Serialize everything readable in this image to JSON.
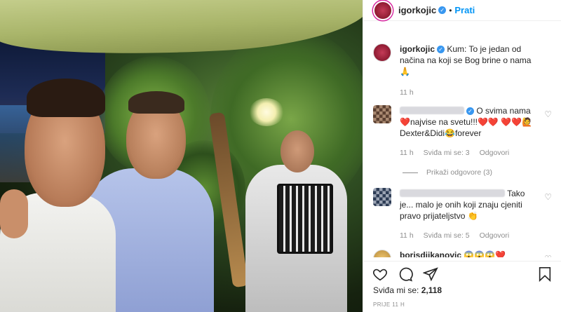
{
  "post": {
    "username": "igorkojic",
    "follow_label": "Prati",
    "dot": "•",
    "caption": {
      "username": "igorkojic",
      "text": "Kum: To je jedan od načina na koji se Bog brine o nama 🙏",
      "time": "11 h"
    },
    "likes_label": "Sviđa mi se:",
    "likes_count": "2,118",
    "posted_time": "PRIJE 11 H"
  },
  "comments": [
    {
      "text": "O svima nama❤️najvise na svetu!!!❤️❤️ ❤️❤️🙋Dexter&Didi😂forever",
      "time": "11 h",
      "likes": "Sviđa mi se: 3",
      "reply": "Odgovori",
      "view_replies": "Prikaži odgovore (3)"
    },
    {
      "text": "Tako je... malo je onih koji znaju cjeniti pravo prijateljstvo 👏",
      "time": "11 h",
      "likes": "Sviđa mi se: 5",
      "reply": "Odgovori"
    },
    {
      "username": "borisdjikanovic",
      "text": "😱😱😱❤️"
    }
  ],
  "colors": {
    "accent": "#0095f6",
    "verified": "#3897f0",
    "heart": "#e0245e",
    "muted": "#8e8e8e"
  },
  "icons": [
    "verified-icon",
    "heart-icon",
    "comment-icon",
    "share-icon",
    "bookmark-icon"
  ]
}
